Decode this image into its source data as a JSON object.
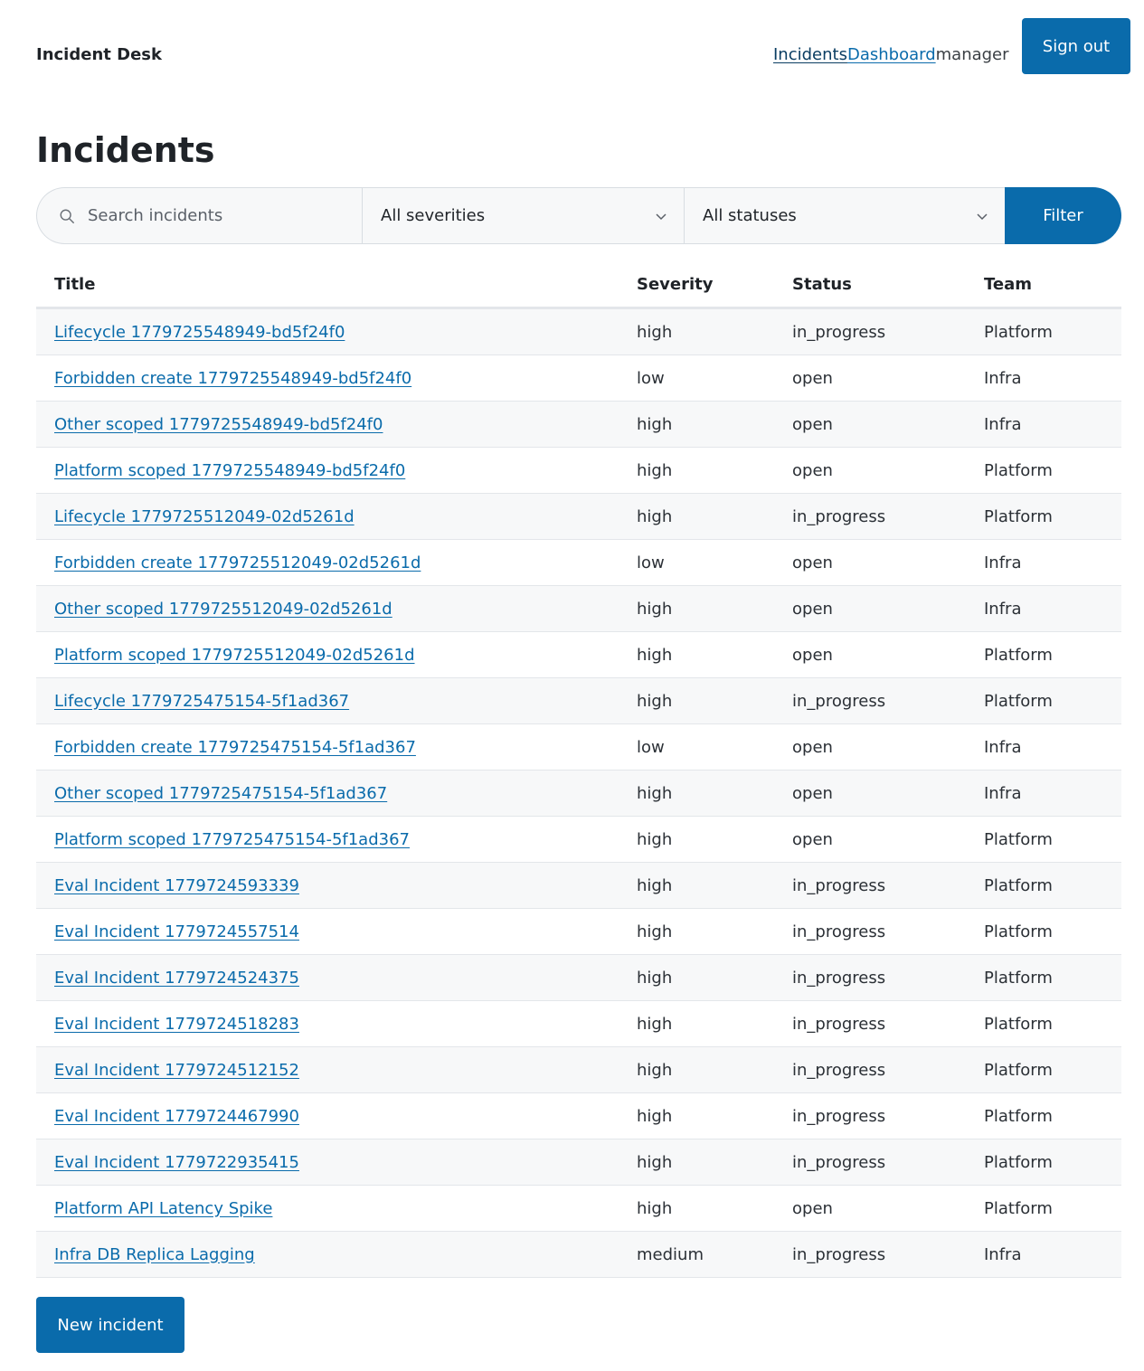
{
  "header": {
    "brand": "Incident Desk",
    "nav": {
      "incidents": "Incidents",
      "dashboard": "Dashboard"
    },
    "user_role": "manager",
    "signout_label": "Sign out"
  },
  "page_title": "Incidents",
  "filters": {
    "search_placeholder": "Search incidents",
    "severity_selected": "All severities",
    "status_selected": "All statuses",
    "filter_label": "Filter"
  },
  "table": {
    "columns": [
      "Title",
      "Severity",
      "Status",
      "Team"
    ],
    "rows": [
      {
        "title": "Lifecycle 1779725548949-bd5f24f0",
        "severity": "high",
        "status": "in_progress",
        "team": "Platform"
      },
      {
        "title": "Forbidden create 1779725548949-bd5f24f0",
        "severity": "low",
        "status": "open",
        "team": "Infra"
      },
      {
        "title": "Other scoped 1779725548949-bd5f24f0",
        "severity": "high",
        "status": "open",
        "team": "Infra"
      },
      {
        "title": "Platform scoped 1779725548949-bd5f24f0",
        "severity": "high",
        "status": "open",
        "team": "Platform"
      },
      {
        "title": "Lifecycle 1779725512049-02d5261d",
        "severity": "high",
        "status": "in_progress",
        "team": "Platform"
      },
      {
        "title": "Forbidden create 1779725512049-02d5261d",
        "severity": "low",
        "status": "open",
        "team": "Infra"
      },
      {
        "title": "Other scoped 1779725512049-02d5261d",
        "severity": "high",
        "status": "open",
        "team": "Infra"
      },
      {
        "title": "Platform scoped 1779725512049-02d5261d",
        "severity": "high",
        "status": "open",
        "team": "Platform"
      },
      {
        "title": "Lifecycle 1779725475154-5f1ad367",
        "severity": "high",
        "status": "in_progress",
        "team": "Platform"
      },
      {
        "title": "Forbidden create 1779725475154-5f1ad367",
        "severity": "low",
        "status": "open",
        "team": "Infra"
      },
      {
        "title": "Other scoped 1779725475154-5f1ad367",
        "severity": "high",
        "status": "open",
        "team": "Infra"
      },
      {
        "title": "Platform scoped 1779725475154-5f1ad367",
        "severity": "high",
        "status": "open",
        "team": "Platform"
      },
      {
        "title": "Eval Incident 1779724593339",
        "severity": "high",
        "status": "in_progress",
        "team": "Platform"
      },
      {
        "title": "Eval Incident 1779724557514",
        "severity": "high",
        "status": "in_progress",
        "team": "Platform"
      },
      {
        "title": "Eval Incident 1779724524375",
        "severity": "high",
        "status": "in_progress",
        "team": "Platform"
      },
      {
        "title": "Eval Incident 1779724518283",
        "severity": "high",
        "status": "in_progress",
        "team": "Platform"
      },
      {
        "title": "Eval Incident 1779724512152",
        "severity": "high",
        "status": "in_progress",
        "team": "Platform"
      },
      {
        "title": "Eval Incident 1779724467990",
        "severity": "high",
        "status": "in_progress",
        "team": "Platform"
      },
      {
        "title": "Eval Incident 1779722935415",
        "severity": "high",
        "status": "in_progress",
        "team": "Platform"
      },
      {
        "title": "Platform API Latency Spike",
        "severity": "high",
        "status": "open",
        "team": "Platform"
      },
      {
        "title": "Infra DB Replica Lagging",
        "severity": "medium",
        "status": "in_progress",
        "team": "Infra"
      }
    ]
  },
  "new_incident_label": "New incident",
  "icons": {
    "search": "search-icon",
    "severity_chevron": "chevron-down-icon",
    "status_chevron": "chevron-down-icon"
  },
  "colors": {
    "accent": "#0a6bab",
    "stripe": "#f7f8f9",
    "border": "#e3e6ea"
  }
}
